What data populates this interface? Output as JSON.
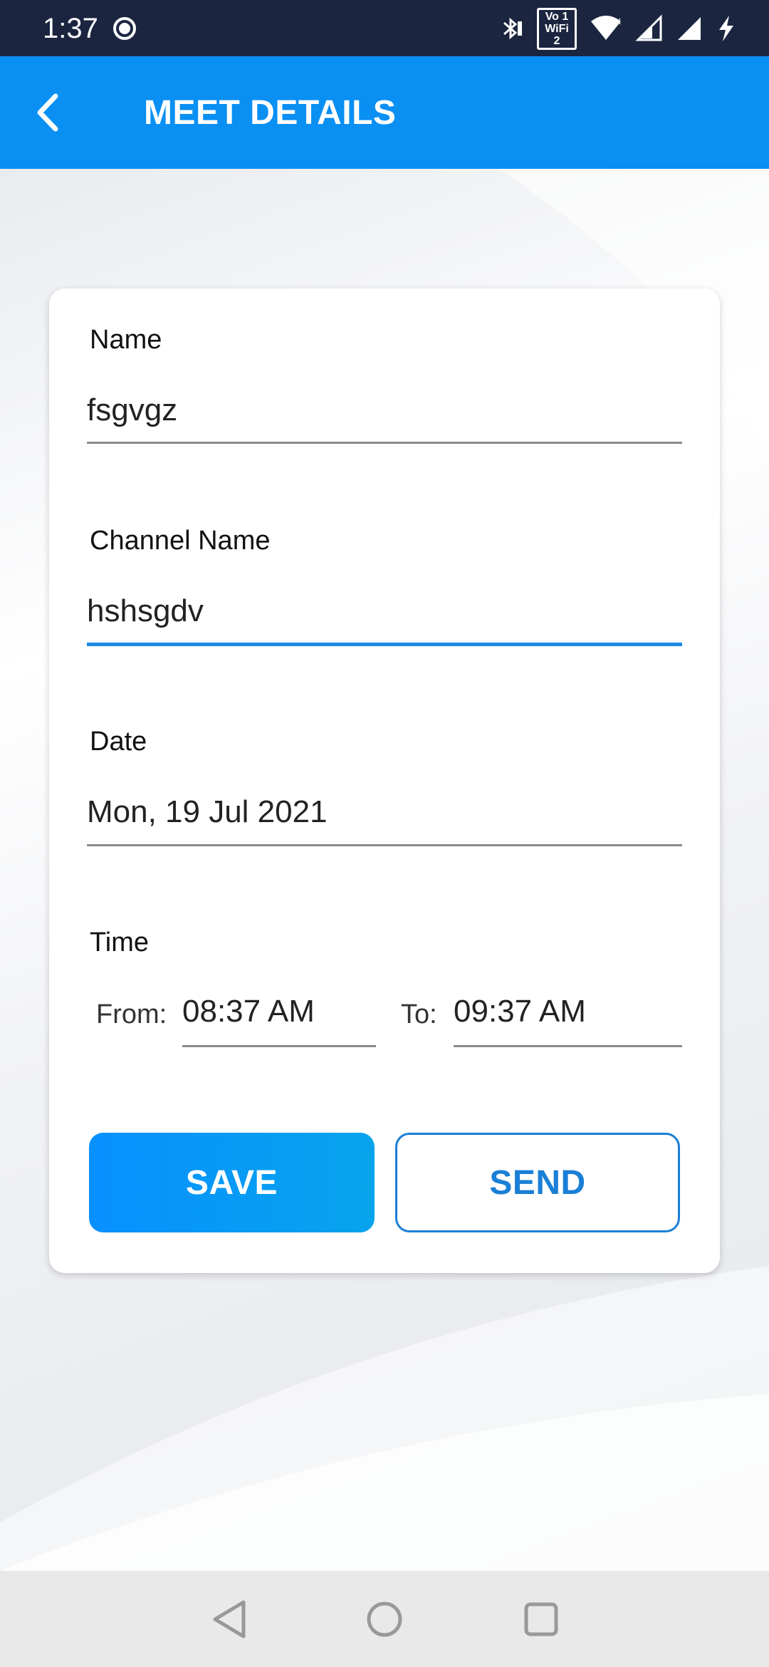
{
  "status_bar": {
    "time": "1:37",
    "wifi_badge_line1": "Vo 1",
    "wifi_badge_line2": "WiFi 2"
  },
  "app_bar": {
    "title": "MEET DETAILS",
    "back_icon": "chevron-left-icon"
  },
  "form": {
    "name": {
      "label": "Name",
      "value": "fsgvgz"
    },
    "channel_name": {
      "label": "Channel Name",
      "value": "hshsgdv"
    },
    "date": {
      "label": "Date",
      "value": "Mon, 19 Jul 2021"
    },
    "time": {
      "label": "Time",
      "from_label": "From:",
      "from_value": "08:37 AM",
      "to_label": "To:",
      "to_value": "09:37 AM"
    }
  },
  "buttons": {
    "save_label": "SAVE",
    "send_label": "SEND"
  },
  "colors": {
    "status_bar": "#1b2540",
    "app_bar": "#0a8ff3",
    "accent": "#1e88e5",
    "send_text": "#1a7fd6"
  }
}
